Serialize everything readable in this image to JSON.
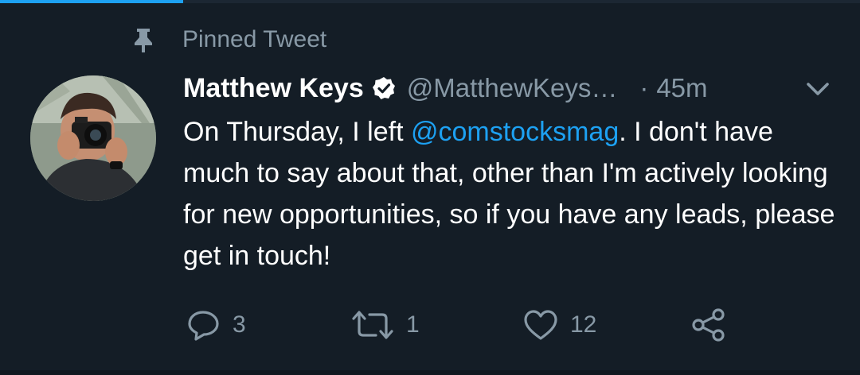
{
  "pinned": {
    "label": "Pinned Tweet"
  },
  "tweet": {
    "display_name": "Matthew Keys",
    "handle": "@MatthewKeys…",
    "separator": "·",
    "time": "45m",
    "text_before": "On Thursday, I left ",
    "mention": "@comstocksmag",
    "text_after": ". I don't have much to say about that, other than I'm actively looking for new opportunities, so if you have any leads, please get in touch!"
  },
  "actions": {
    "reply_count": "3",
    "retweet_count": "1",
    "like_count": "12"
  },
  "icons": {
    "pin": "pin-icon",
    "verified": "verified-badge-icon",
    "chevron": "chevron-down-icon",
    "reply": "reply-icon",
    "retweet": "retweet-icon",
    "like": "heart-icon",
    "share": "share-icon"
  },
  "colors": {
    "background": "#141d26",
    "accent": "#1da1f2",
    "secondary_text": "#8899a6",
    "primary_text": "#ffffff"
  }
}
